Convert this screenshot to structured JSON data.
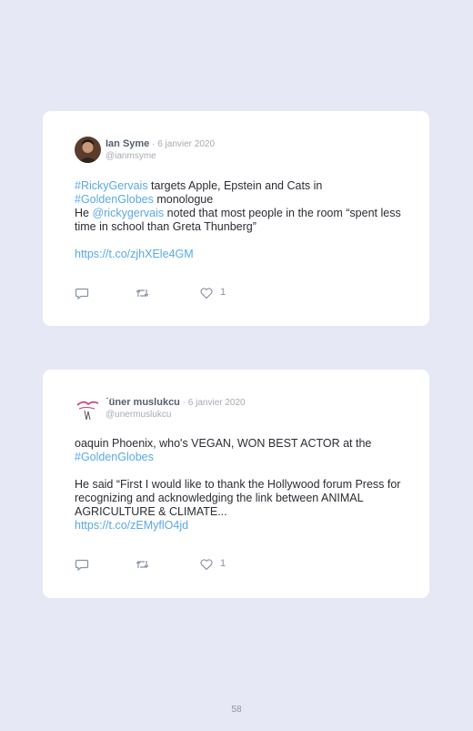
{
  "tweets": [
    {
      "name": "Ian Syme",
      "date": " · 6 janvier 2020",
      "handle": "@ianmsyme",
      "p1_link1": "#RickyGervais",
      "p1_text1": " targets Apple, Epstein and Cats in ",
      "p1_link2": "#GoldenGlobes",
      "p1_text2": " monologue",
      "p2_text1": "He ",
      "p2_link1": "@rickygervais",
      "p2_text2": " noted that most people in the room “spent less time in school than Greta Thunberg”",
      "url": "https://t.co/zjhXEle4GM",
      "likes": "1",
      "icons": {
        "reply": "reply-icon",
        "retweet": "retweet-icon",
        "like": "heart-icon"
      }
    },
    {
      "name": "˙üner muslukcu",
      "date": " · 6 janvier 2020",
      "handle": "@unermuslukcu",
      "p1_text1": "oaquin Phoenix, who's VEGAN, WON BEST ACTOR at the ",
      "p1_link1": "#GoldenGlobes",
      "p2_text1": "He said “First I would like to thank the Hollywood forum Press for recognizing and acknowledging the link between ANIMAL AGRICULTURE & CLIMATE...",
      "url": "https://t.co/zEMyflO4jd",
      "likes": "1",
      "icons": {
        "reply": "reply-icon",
        "retweet": "retweet-icon",
        "like": "heart-icon"
      }
    }
  ],
  "page_number": "58",
  "colors": {
    "background": "#e6e8f5",
    "card": "#ffffff",
    "link": "#5aa9e6",
    "icon": "#8a93a0"
  }
}
